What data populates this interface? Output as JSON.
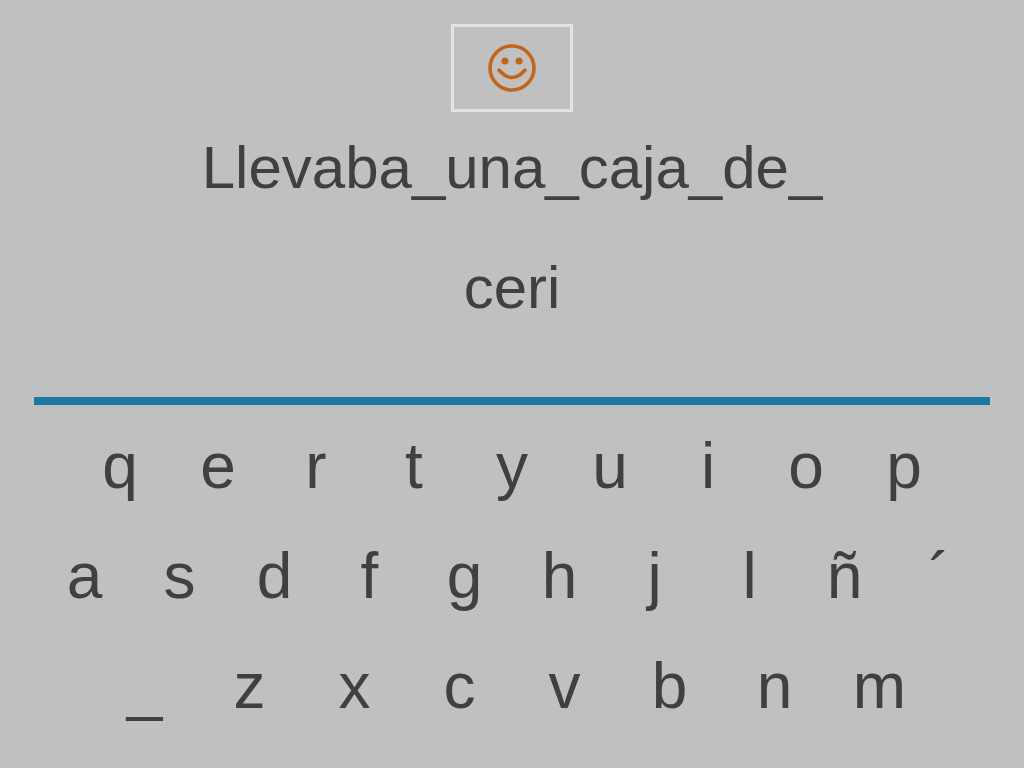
{
  "sentence": [
    "Llevaba_una_caja_de_",
    "ceri"
  ],
  "keyboard": {
    "rows": [
      [
        "q",
        "e",
        "r",
        "t",
        "y",
        "u",
        "i",
        "o",
        "p"
      ],
      [
        "a",
        "s",
        "d",
        "f",
        "g",
        "h",
        "j",
        "l",
        "ñ",
        "´"
      ],
      [
        "_",
        "z",
        "x",
        "c",
        "v",
        "b",
        "n",
        "m"
      ]
    ]
  }
}
